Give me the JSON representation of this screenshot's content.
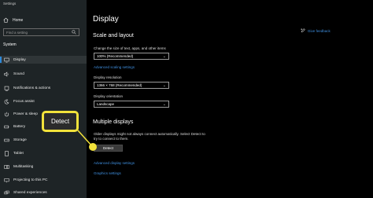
{
  "window": {
    "title": "Settings"
  },
  "sidebar": {
    "home_label": "Home",
    "search_placeholder": "Find a setting",
    "section_label": "System",
    "items": [
      {
        "label": "Display",
        "icon": "monitor-icon",
        "selected": true
      },
      {
        "label": "Sound",
        "icon": "speaker-icon"
      },
      {
        "label": "Notifications & actions",
        "icon": "notifications-icon"
      },
      {
        "label": "Focus assist",
        "icon": "moon-icon"
      },
      {
        "label": "Power & sleep",
        "icon": "power-icon"
      },
      {
        "label": "Battery",
        "icon": "battery-icon"
      },
      {
        "label": "Storage",
        "icon": "storage-icon"
      },
      {
        "label": "Tablet",
        "icon": "tablet-icon"
      },
      {
        "label": "Multitasking",
        "icon": "multitasking-icon"
      },
      {
        "label": "Projecting to this PC",
        "icon": "projector-icon"
      },
      {
        "label": "Shared experiences",
        "icon": "shared-experiences-icon"
      }
    ]
  },
  "main": {
    "page_title": "Display",
    "feedback_link": "Give feedback",
    "scale_section": {
      "heading": "Scale and layout",
      "change_size_label": "Change the size of text, apps, and other items",
      "scale_value": "100% (Recommended)",
      "advanced_scaling_link": "Advanced scaling settings",
      "resolution_label": "Display resolution",
      "resolution_value": "1366 × 768 (Recommended)",
      "orientation_label": "Display orientation",
      "orientation_value": "Landscape"
    },
    "multiple_section": {
      "heading": "Multiple displays",
      "description_line1": "Older displays might not always connect automatically. Select Detect to",
      "description_line2": "try to connect to them.",
      "detect_label": "Detect",
      "advanced_display_link": "Advanced display settings",
      "graphics_link": "Graphics settings"
    }
  },
  "callout": {
    "label": "Detect"
  },
  "colors": {
    "accent": "#3f8fdf",
    "highlight": "#f2e23b",
    "sidebar_bg": "#1e2426",
    "main_bg": "#000000"
  }
}
